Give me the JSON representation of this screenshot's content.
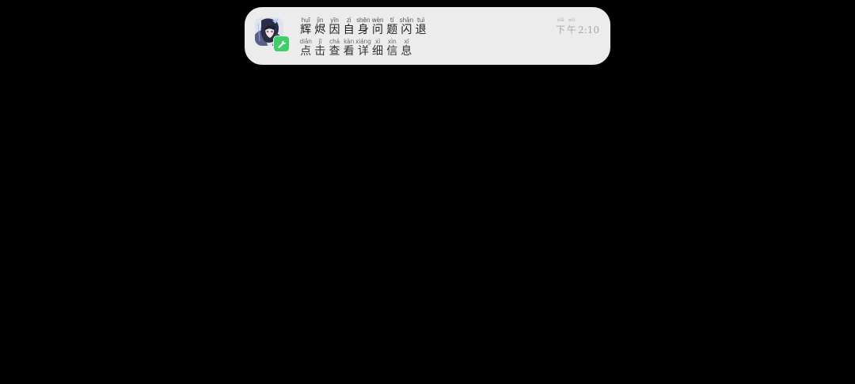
{
  "notification": {
    "app_icon": "game-character-avatar-icon",
    "badge_icon": "wrench-tool-icon",
    "badge_color": "#3fce67",
    "title": [
      {
        "py": "huī",
        "hz": "辉"
      },
      {
        "py": "jìn",
        "hz": "烬"
      },
      {
        "py": "yīn",
        "hz": "因"
      },
      {
        "py": "zì",
        "hz": "自"
      },
      {
        "py": "shēn",
        "hz": "身"
      },
      {
        "py": "wèn",
        "hz": "问"
      },
      {
        "py": "tí",
        "hz": "题"
      },
      {
        "py": "shǎn",
        "hz": "闪"
      },
      {
        "py": "tuì",
        "hz": "退"
      }
    ],
    "body": [
      {
        "py": "diǎn",
        "hz": "点"
      },
      {
        "py": "jī",
        "hz": "击"
      },
      {
        "py": "chá",
        "hz": "查"
      },
      {
        "py": "kàn",
        "hz": "看"
      },
      {
        "py": "xiáng",
        "hz": "详"
      },
      {
        "py": "xì",
        "hz": "细"
      },
      {
        "py": "xìn",
        "hz": "信"
      },
      {
        "py": "xī",
        "hz": "息"
      }
    ],
    "time_prefix": [
      {
        "py": "xià",
        "hz": "下"
      },
      {
        "py": "wǔ",
        "hz": "午"
      }
    ],
    "time_value": "2:10"
  }
}
